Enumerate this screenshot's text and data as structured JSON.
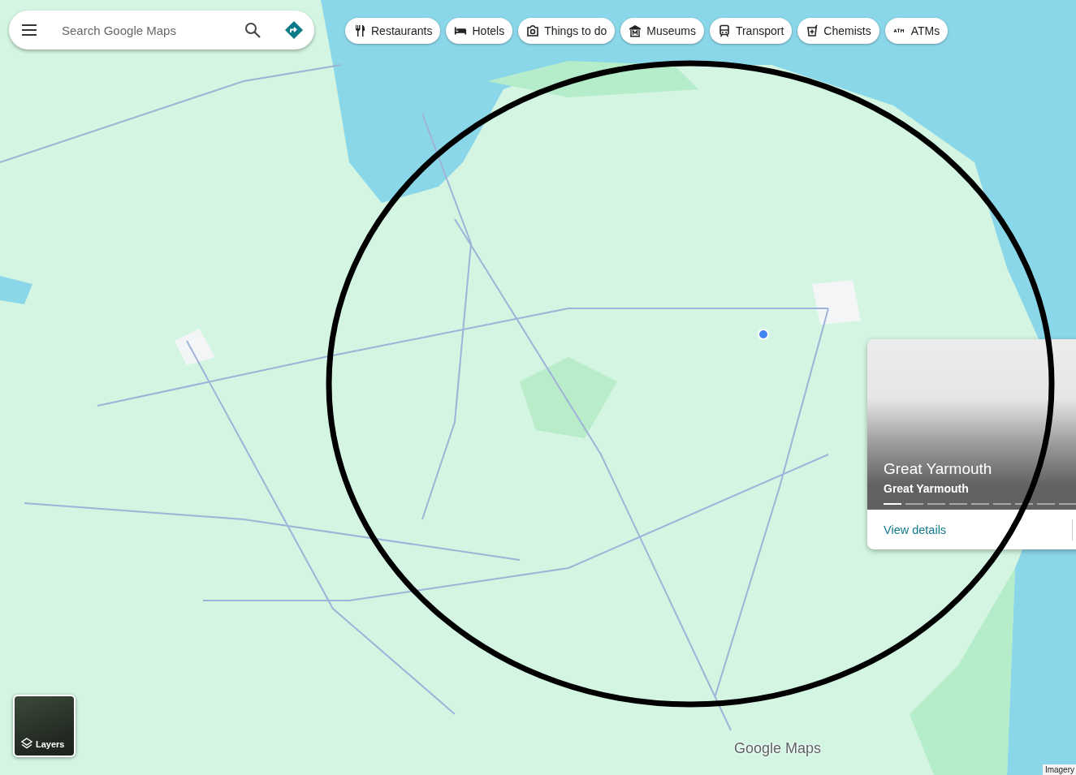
{
  "search": {
    "placeholder": "Search Google Maps"
  },
  "chips": [
    {
      "label": "Restaurants",
      "kind": "restaurant"
    },
    {
      "label": "Hotels",
      "kind": "hotel"
    },
    {
      "label": "Things to do",
      "kind": "camera"
    },
    {
      "label": "Museums",
      "kind": "museum"
    },
    {
      "label": "Transport",
      "kind": "train"
    },
    {
      "label": "Chemists",
      "kind": "chemist"
    },
    {
      "label": "ATMs",
      "kind": "atm"
    }
  ],
  "place_card": {
    "title": "Great Yarmouth",
    "subtitle": "Great Yarmouth",
    "photos": [
      {
        "selected": true
      },
      {
        "selected": false
      },
      {
        "selected": false
      },
      {
        "selected": false
      },
      {
        "selected": false
      },
      {
        "selected": false
      },
      {
        "selected": false
      },
      {
        "selected": false
      },
      {
        "selected": false
      }
    ],
    "action": "View details"
  },
  "layers": {
    "label": "Layers"
  },
  "logo": "Google Maps",
  "attribution": "Imagery"
}
